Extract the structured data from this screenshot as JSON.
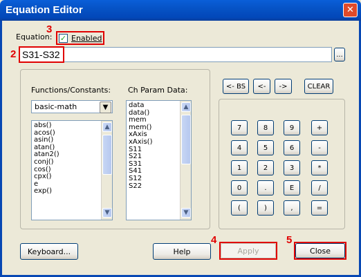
{
  "window": {
    "title": "Equation Editor",
    "close_glyph": "✕"
  },
  "equation": {
    "label": "Equation:",
    "enabled_label": "Enabled",
    "enabled_checked": true,
    "value": "S31-S32",
    "browse_label": "..."
  },
  "functions": {
    "label": "Functions/Constants:",
    "selected": "basic-math",
    "items": [
      "abs()",
      "acos()",
      "asin()",
      "atan()",
      "atan2()",
      "conj()",
      "cos()",
      "cpx()",
      "e",
      "exp()"
    ]
  },
  "ch_param": {
    "label": "Ch Param Data:",
    "items": [
      "data",
      "data()",
      "mem",
      "mem()",
      "xAxis",
      "xAxis()",
      "S11",
      "S21",
      "S31",
      "S41",
      "S12",
      "S22"
    ]
  },
  "edit_buttons": [
    "<- BS",
    "<-",
    "->",
    "CLEAR"
  ],
  "keypad": [
    [
      "7",
      "8",
      "9",
      "+"
    ],
    [
      "4",
      "5",
      "6",
      "-"
    ],
    [
      "1",
      "2",
      "3",
      "*"
    ],
    [
      "0",
      ".",
      "E",
      "/"
    ],
    [
      "(",
      ")",
      ",",
      "="
    ]
  ],
  "bottom": {
    "keyboard": "Keyboard...",
    "help": "Help",
    "apply": "Apply",
    "close": "Close"
  },
  "annotations": {
    "n2": "2",
    "n3": "3",
    "n4": "4",
    "n5": "5",
    "color": "#e00000"
  },
  "icons": {
    "dropdown": "chevron-down-icon",
    "scroll_up": "chevron-up-icon",
    "scroll_down": "chevron-down-icon"
  }
}
